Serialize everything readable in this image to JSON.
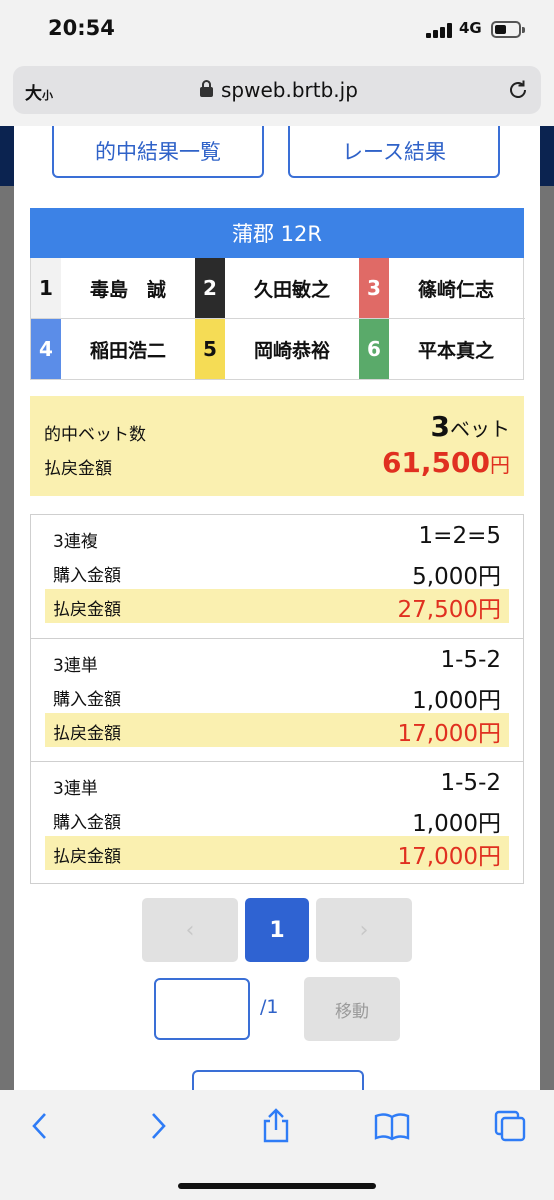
{
  "status_bar": {
    "time": "20:54",
    "network": "4G"
  },
  "browser": {
    "text_size_label": "大",
    "text_size_small": "小",
    "url": "spweb.brtb.jp"
  },
  "nav_buttons": {
    "results_list": "的中結果一覧",
    "race_results": "レース結果"
  },
  "race": {
    "title": "蒲郡 12R",
    "racers": [
      {
        "num": "1",
        "name": "毒島　誠",
        "bg": "#f2f2f2",
        "fg": "#111111"
      },
      {
        "num": "2",
        "name": "久田敏之",
        "bg": "#2b2b2b",
        "fg": "#ffffff"
      },
      {
        "num": "3",
        "name": "篠崎仁志",
        "bg": "#e06a66",
        "fg": "#ffffff"
      },
      {
        "num": "4",
        "name": "稲田浩二",
        "bg": "#5b8de8",
        "fg": "#ffffff"
      },
      {
        "num": "5",
        "name": "岡崎恭裕",
        "bg": "#f5dc55",
        "fg": "#111111"
      },
      {
        "num": "6",
        "name": "平本真之",
        "bg": "#5aaa6a",
        "fg": "#ffffff"
      }
    ]
  },
  "summary": {
    "hit_bets_label": "的中ベット数",
    "hit_bets_value": "3",
    "hit_bets_unit": "ベット",
    "payout_label": "払戻金額",
    "payout_value": "61,500",
    "payout_unit": "円"
  },
  "bets": [
    {
      "type": "3連複",
      "combo": "1=2=5",
      "purchase_label": "購入金額",
      "purchase": "5,000円",
      "payout_label": "払戻金額",
      "payout": "27,500円"
    },
    {
      "type": "3連単",
      "combo": "1-5-2",
      "purchase_label": "購入金額",
      "purchase": "1,000円",
      "payout_label": "払戻金額",
      "payout": "17,000円"
    },
    {
      "type": "3連単",
      "combo": "1-5-2",
      "purchase_label": "購入金額",
      "purchase": "1,000円",
      "payout_label": "払戻金額",
      "payout": "17,000円"
    }
  ],
  "pagination": {
    "prev": "‹",
    "current": "1",
    "next": "›",
    "total": "/1",
    "jump_label": "移動",
    "input_value": ""
  },
  "colors": {
    "accent": "#2f63d2",
    "highlight": "#faf0b0",
    "payout_red": "#e03020"
  },
  "toolbar_icons": [
    "back-icon",
    "forward-icon",
    "share-icon",
    "bookmarks-icon",
    "tabs-icon"
  ]
}
